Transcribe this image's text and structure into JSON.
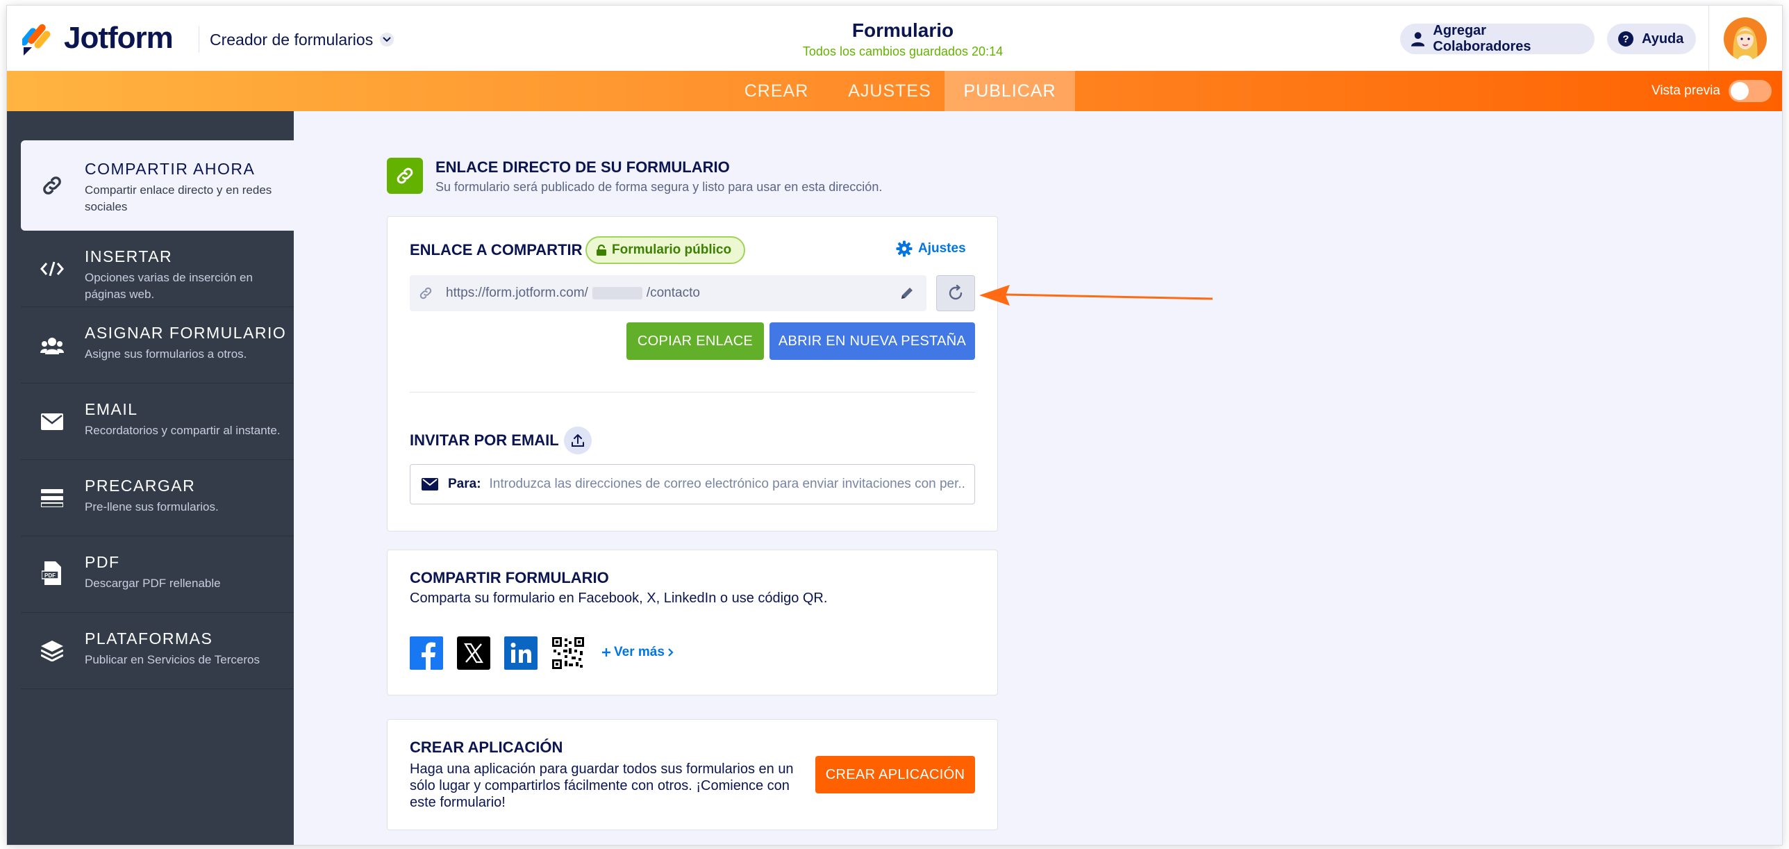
{
  "header": {
    "brand": "Jotform",
    "builder_label": "Creador de formularios",
    "form_title": "Formulario",
    "saved_status": "Todos los cambios guardados 20:14",
    "collaborators_label": "Agregar Colaboradores",
    "help_label": "Ayuda"
  },
  "nav": {
    "tabs": [
      {
        "label": "CREAR",
        "active": false
      },
      {
        "label": "AJUSTES",
        "active": false
      },
      {
        "label": "PUBLICAR",
        "active": true
      }
    ],
    "preview_label": "Vista previa"
  },
  "sidebar": {
    "items": [
      {
        "title": "COMPARTIR AHORA",
        "desc": "Compartir enlace directo y en redes sociales",
        "icon": "link-icon",
        "active": true
      },
      {
        "title": "INSERTAR",
        "desc": "Opciones varias de inserción en páginas web.",
        "icon": "code-icon"
      },
      {
        "title": "ASIGNAR FORMULARIO",
        "desc": "Asigne sus formularios a otros.",
        "icon": "users-icon"
      },
      {
        "title": "EMAIL",
        "desc": "Recordatorios y compartir al instante.",
        "icon": "envelope-icon"
      },
      {
        "title": "PRECARGAR",
        "desc": "Pre-llene sus formularios.",
        "icon": "prefill-icon"
      },
      {
        "title": "PDF",
        "desc": "Descargar PDF rellenable",
        "icon": "pdf-icon"
      },
      {
        "title": "PLATAFORMAS",
        "desc": "Publicar en Servicios de Terceros",
        "icon": "layers-icon"
      }
    ]
  },
  "main": {
    "section_title": "ENLACE DIRECTO DE SU FORMULARIO",
    "section_desc": "Su formulario será publicado de forma segura y listo para usar en esta dirección.",
    "share": {
      "title": "ENLACE A COMPARTIR",
      "badge": "Formulario público",
      "settings_label": "Ajustes",
      "url_prefix": "https://form.jotform.com/",
      "url_suffix": "/contacto",
      "copy_label": "COPIAR ENLACE",
      "open_label": "ABRIR EN NUEVA PESTAÑA"
    },
    "invite": {
      "title": "INVITAR POR EMAIL",
      "to_label": "Para:",
      "placeholder": "Introduzca las direcciones de correo electrónico para enviar invitaciones con per..."
    },
    "share_form": {
      "title": "COMPARTIR FORMULARIO",
      "desc": "Comparta su formulario en Facebook, X, LinkedIn o use código QR.",
      "see_more": "Ver más"
    },
    "app": {
      "title": "CREAR APLICACIÓN",
      "desc_lines": [
        "Haga una aplicación para guardar todos sus formularios en un",
        "sólo lugar y compartirlos fácilmente con otros. ¡Comience con",
        "este formulario!"
      ],
      "button_label": "CREAR APLICACIÓN"
    }
  },
  "colors": {
    "brand_navy": "#0a1551",
    "accent_orange": "#ff6100",
    "success_green": "#64b200",
    "link_blue": "#0075e3",
    "sidebar_bg": "#343c4a"
  }
}
